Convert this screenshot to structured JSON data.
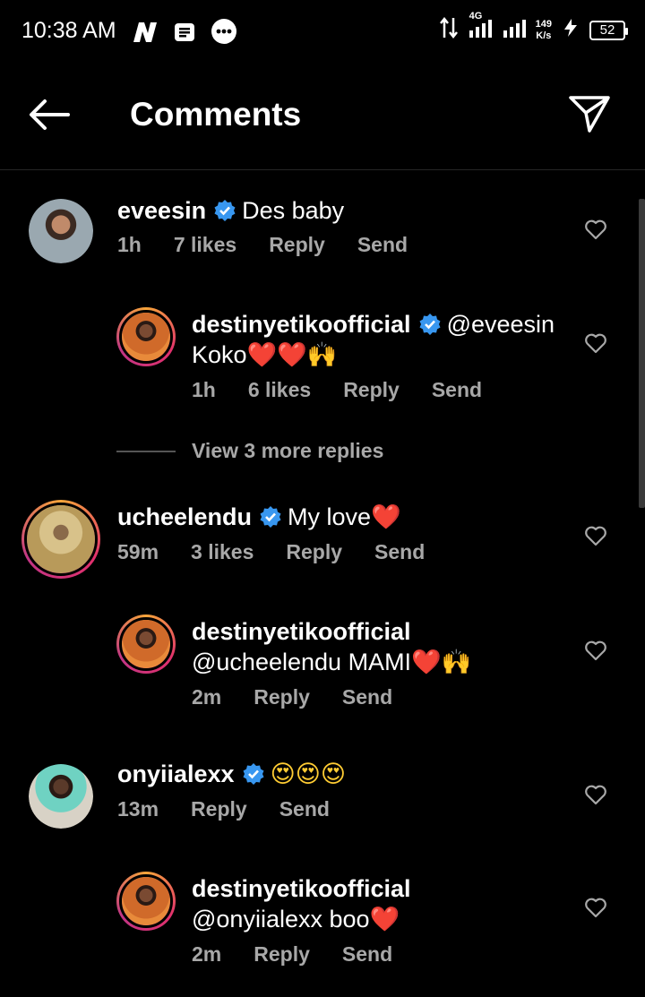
{
  "status_bar": {
    "time": "10:38 AM",
    "network_type": "4G",
    "net_speed_value": "149",
    "net_speed_unit": "K/s",
    "battery": "52"
  },
  "header": {
    "title": "Comments",
    "icons": [
      "back-arrow-icon",
      "send-paper-plane-icon"
    ]
  },
  "comments": [
    {
      "username": "eveesin",
      "verified": true,
      "text": "Des baby",
      "time": "1h",
      "likes": "7 likes",
      "reply_label": "Reply",
      "send_label": "Send"
    },
    {
      "username": "destinyetikoofficial",
      "verified": true,
      "mention": "@eveesin",
      "text": "Koko",
      "emoji": "❤️❤️🙌",
      "time": "1h",
      "likes": "6 likes",
      "reply_label": "Reply",
      "send_label": "Send"
    },
    {
      "username": "ucheelendu",
      "verified": true,
      "text": "My love",
      "emoji": "❤️",
      "time": "59m",
      "likes": "3 likes",
      "reply_label": "Reply",
      "send_label": "Send"
    },
    {
      "username": "destinyetikoofficial",
      "mention": "@ucheelendu",
      "text": "MAMI",
      "emoji": "❤️🙌",
      "time": "2m",
      "reply_label": "Reply",
      "send_label": "Send"
    },
    {
      "username": "onyiialexx",
      "verified": true,
      "emoji": "😍😍😍",
      "time": "13m",
      "reply_label": "Reply",
      "send_label": "Send"
    },
    {
      "username": "destinyetikoofficial",
      "mention": "@onyiialexx",
      "text": "boo",
      "emoji": "❤️",
      "time": "2m",
      "reply_label": "Reply",
      "send_label": "Send"
    }
  ],
  "view_more_replies": "View 3 more replies",
  "colors": {
    "background": "#000000",
    "verified_blue": "#3897f0",
    "meta_gray": "#a8a8a8",
    "heart_red": "#ff2a3d"
  }
}
